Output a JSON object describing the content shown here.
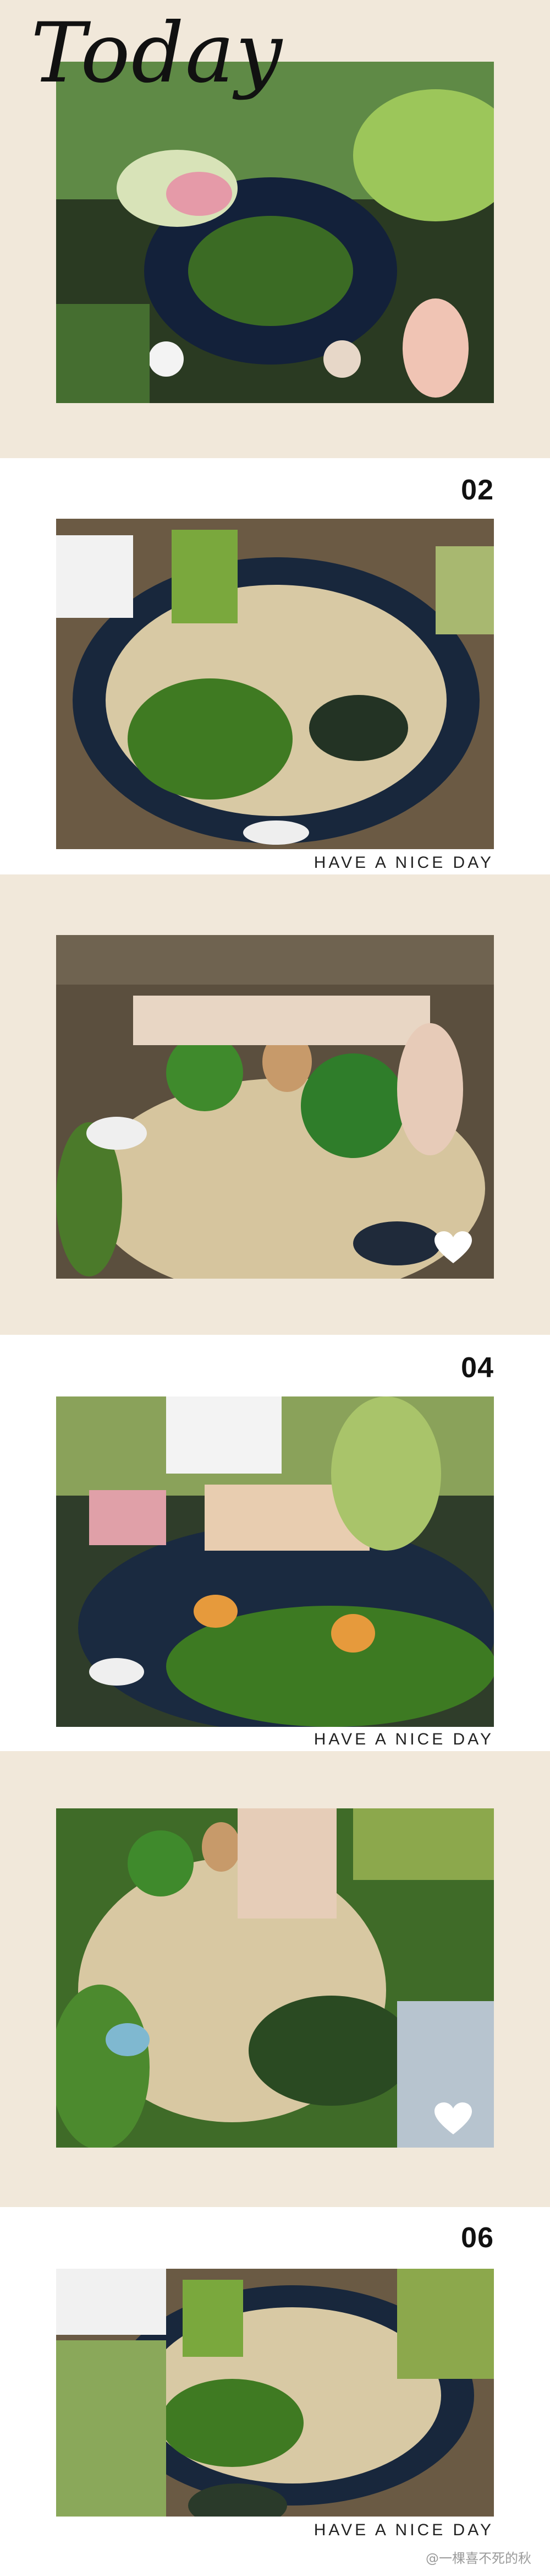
{
  "header": {
    "title": "Today"
  },
  "slides": [
    {
      "number": "",
      "caption": ""
    },
    {
      "number": "02",
      "caption": "HAVE A NICE DAY"
    },
    {
      "number": "",
      "caption": ""
    },
    {
      "number": "04",
      "caption": "HAVE A NICE DAY"
    },
    {
      "number": "",
      "caption": ""
    },
    {
      "number": "06",
      "caption": "HAVE A NICE DAY"
    }
  ],
  "watermark": {
    "text": "@一棵喜不死的秋"
  },
  "colors": {
    "beige_panel": "#f1e8da",
    "white_panel": "#ffffff",
    "moss": "#3f7a22",
    "sand": "#d9c9a3",
    "pot": "#1d2b40"
  }
}
